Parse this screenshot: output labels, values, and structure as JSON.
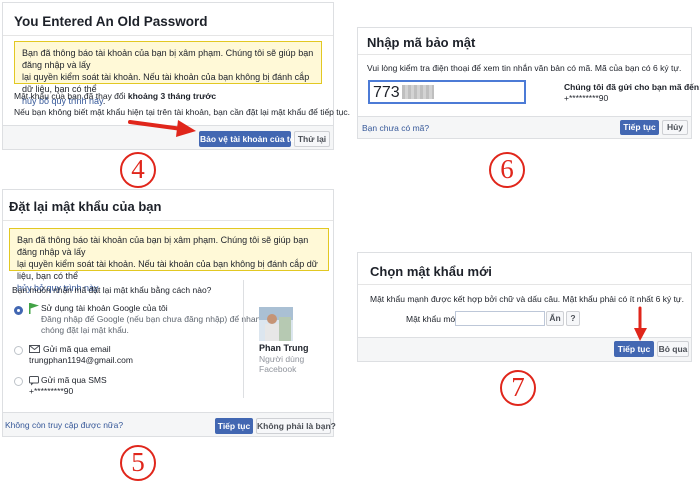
{
  "colors": {
    "primary_blue": "#4267b2",
    "link": "#365899",
    "notice_bg": "#fff9d7",
    "notice_border": "#e2c822",
    "annotation_red": "#e0261b"
  },
  "panel4": {
    "title": "You Entered An Old Password",
    "notice_line1": "Bạn đã thông báo tài khoản của bạn bị xâm phạm. Chúng tôi sẽ giúp bạn đăng nhập và lấy",
    "notice_line2": "lại quyền kiểm soát tài khoản. Nếu tài khoản của bạn không bị đánh cắp dữ liệu, bạn có thể",
    "notice_link": "hủy bỏ quy trình này",
    "notice_end": ".",
    "changed_prefix": "Mật khẩu của bạn đã thay đổi ",
    "changed_bold": "khoảng 3 tháng trước",
    "unknown_text": "Nếu bạn không biết mật khẩu hiện tại trên tài khoản, bạn cần đặt lại mật khẩu để tiếp tục.",
    "secure_button": "Bảo vệ tài khoản của tôi",
    "retry_button": "Thử lại",
    "step_label": "4"
  },
  "panel5": {
    "title": "Đặt lại mật khẩu của bạn",
    "notice_line1": "Bạn đã thông báo tài khoản của bạn bị xâm phạm. Chúng tôi sẽ giúp bạn đăng nhập và lấy",
    "notice_line2": "lại quyền kiểm soát tài khoản. Nếu tài khoản của bạn không bị đánh cắp dữ liệu, bạn có thể",
    "notice_link": "hủy bỏ quy trình này",
    "notice_end": ".",
    "question": "Bạn muốn nhận mã đặt lại mật khẩu bằng cách nào?",
    "option_google_title": "Sử dụng tài khoản Google của tôi",
    "option_google_desc1": "Đăng nhập đế Google (nếu bạn chưa đăng nhập) để nhanh",
    "option_google_desc2": "chóng đặt lại mật khẩu.",
    "option_email_title": "Gửi mã qua email",
    "option_email_value": "trungphan1194@gmail.com",
    "option_sms_title": "Gửi mã qua SMS",
    "option_sms_value": "+*********90",
    "profile_name": "Phan Trung",
    "profile_role": "Người dùng",
    "profile_site": "Facebook",
    "no_access_link": "Không còn truy cập được nữa?",
    "continue_button": "Tiếp tục",
    "not_you_button": "Không phải là bạn?",
    "step_label": "5"
  },
  "panel6": {
    "title": "Nhập mã bảo mật",
    "instruction": "Vui lòng kiểm tra điện thoại để xem tin nhắn văn bản có mã. Mã của bạn có 6 ký tự.",
    "code_value": "773",
    "sent_label": "Chúng tôi đã gửi cho bạn mã đến:",
    "sent_number": "+*********90",
    "no_code_link": "Bạn chưa có mã?",
    "continue_button": "Tiếp tục",
    "cancel_button": "Hủy",
    "step_label": "6"
  },
  "panel7": {
    "title": "Chọn mật khẩu mới",
    "instruction": "Mật khẩu mạnh được kết hợp bởi chữ và dấu câu. Mật khẩu phải có ít nhất 6 ký tự.",
    "new_password_label": "Mật khẩu mới",
    "hide_button": "Ẩn",
    "help_button": "?",
    "continue_button": "Tiếp tục",
    "skip_button": "Bỏ qua",
    "step_label": "7"
  }
}
